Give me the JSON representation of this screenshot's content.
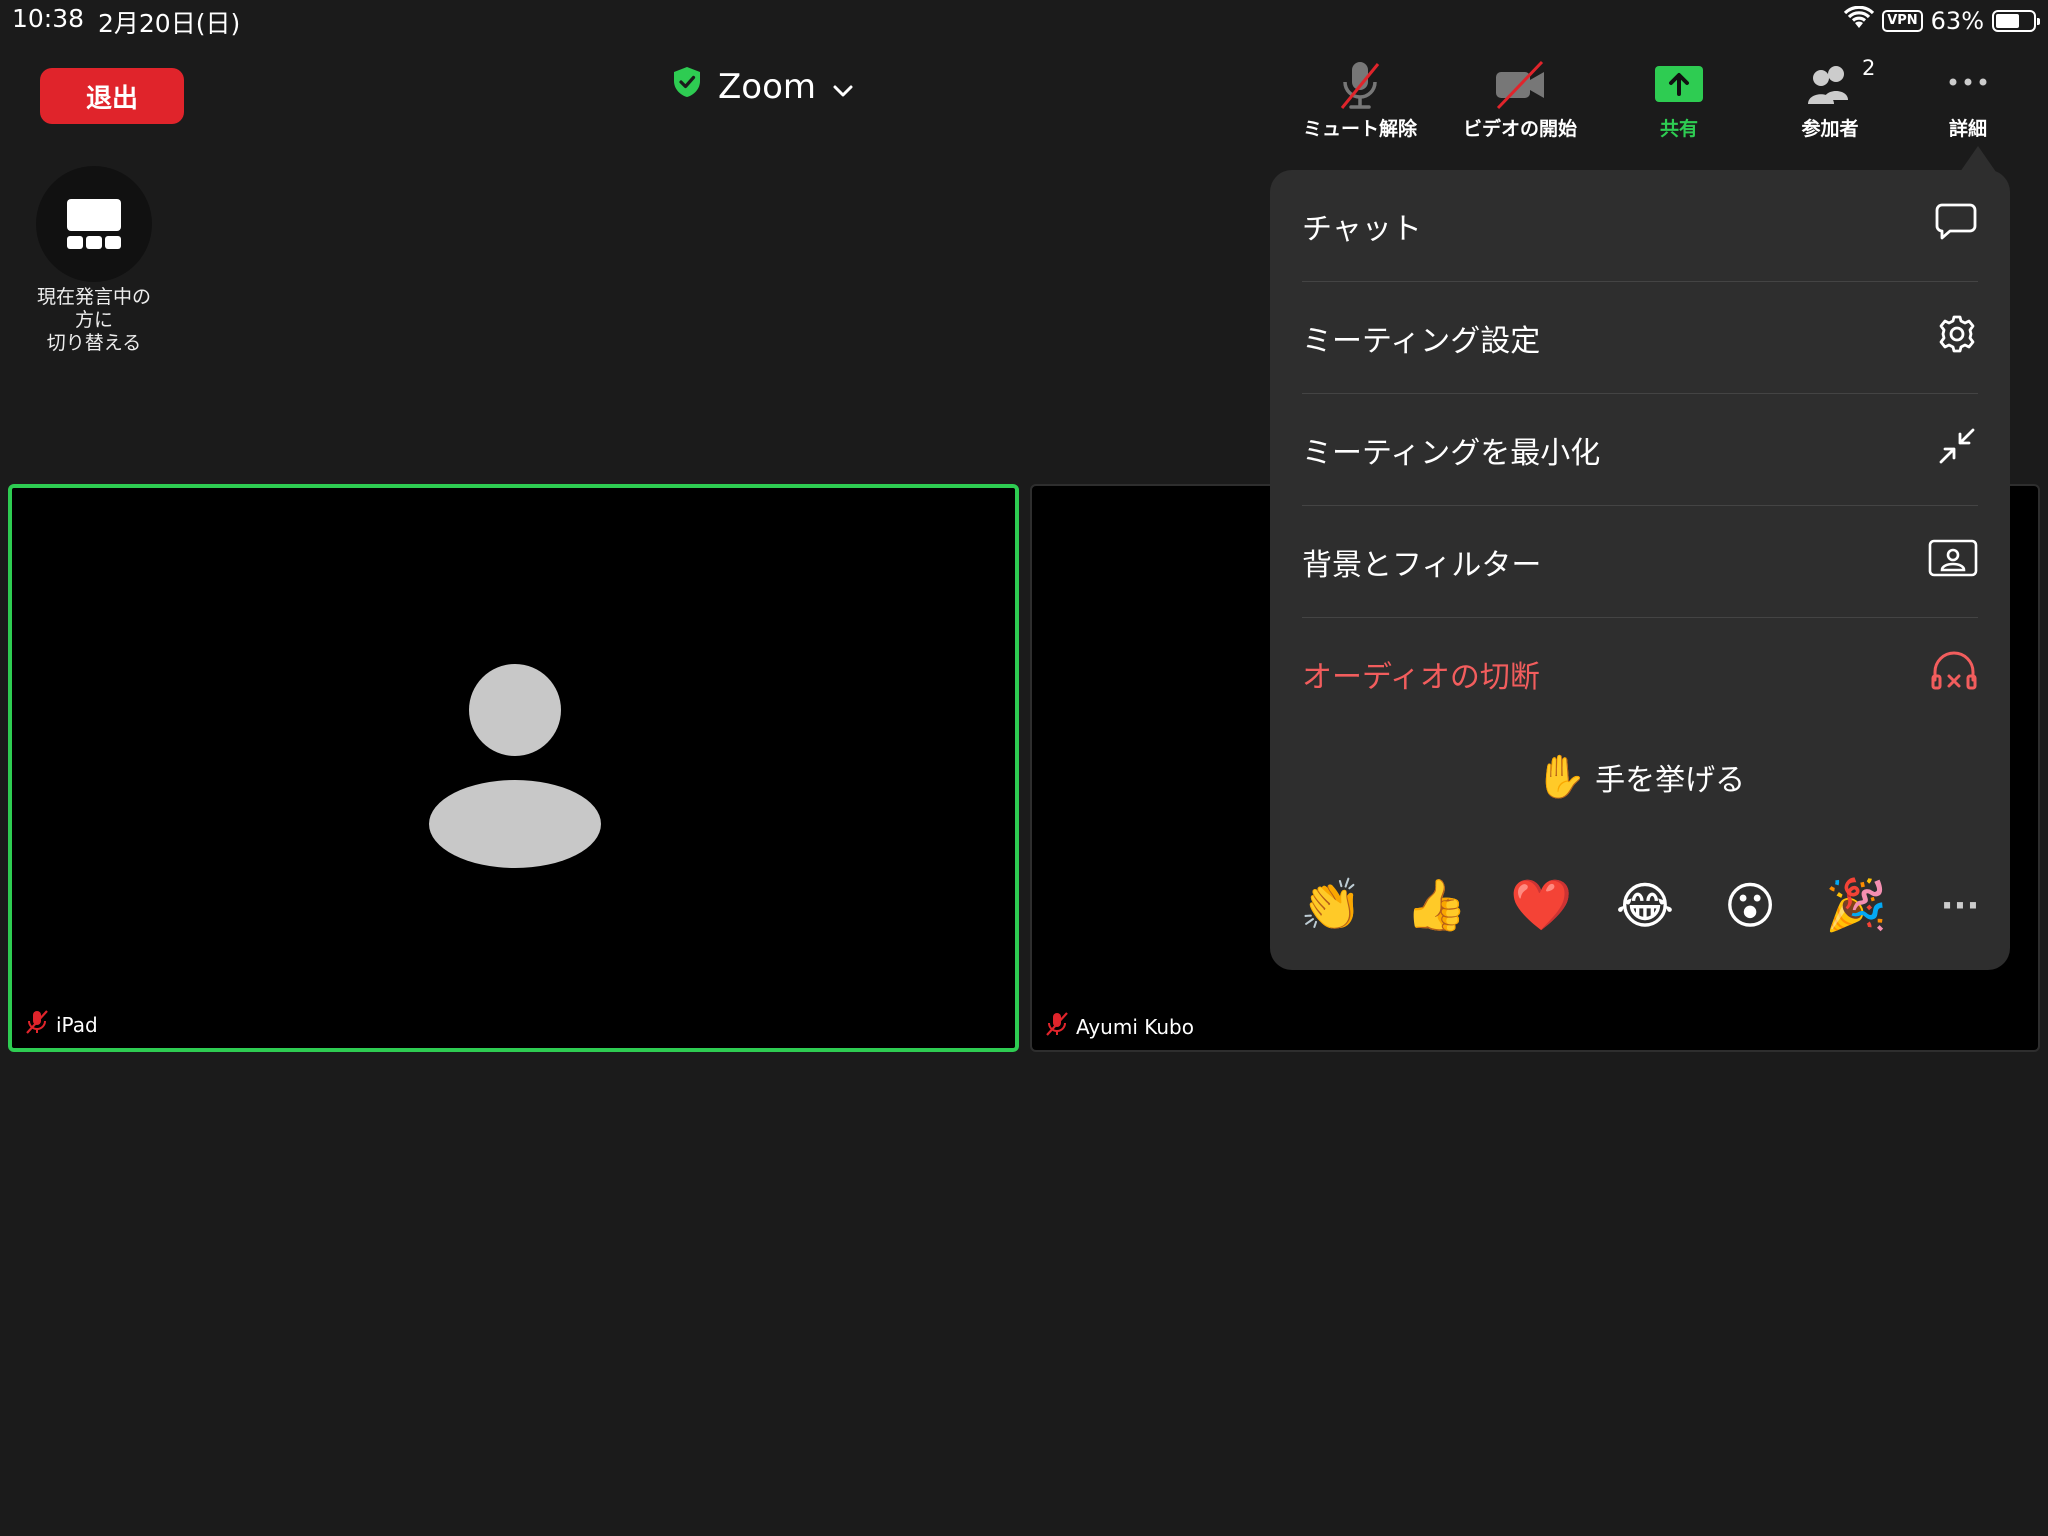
{
  "status_bar": {
    "time": "10:38",
    "date": "2月20日(日)",
    "vpn": "VPN",
    "battery": "63%",
    "battery_level": 0.63
  },
  "leave_button": "退出",
  "meeting": {
    "title": "Zoom"
  },
  "toolbar": {
    "unmute": "ミュート解除",
    "start_video": "ビデオの開始",
    "share": "共有",
    "participants": "参加者",
    "participants_count": "2",
    "more": "詳細"
  },
  "speaker_switch": {
    "line1": "現在発言中の",
    "line2": "方に",
    "line3": "切り替える"
  },
  "tiles": [
    {
      "name": "iPad",
      "active": true
    },
    {
      "name": "Ayumi Kubo",
      "active": false
    }
  ],
  "menu": {
    "items": [
      {
        "label": "チャット",
        "icon": "chat-bubble-icon"
      },
      {
        "label": "ミーティング設定",
        "icon": "gear-icon"
      },
      {
        "label": "ミーティングを最小化",
        "icon": "minimize-arrows-icon"
      },
      {
        "label": "背景とフィルター",
        "icon": "background-portrait-icon"
      },
      {
        "label": "オーディオの切断",
        "icon": "headphones-disconnect-icon"
      }
    ],
    "raise_hand_emoji": "✋",
    "raise_hand": "手を挙げる",
    "reactions": [
      "👏",
      "👍",
      "❤️",
      "😂",
      "😮",
      "🎉"
    ],
    "more_reactions": "···"
  },
  "colors": {
    "accent_green": "#2ecc52",
    "danger_red": "#e0242b",
    "menu_red": "#f25d5d",
    "background": "#1b1b1b"
  }
}
